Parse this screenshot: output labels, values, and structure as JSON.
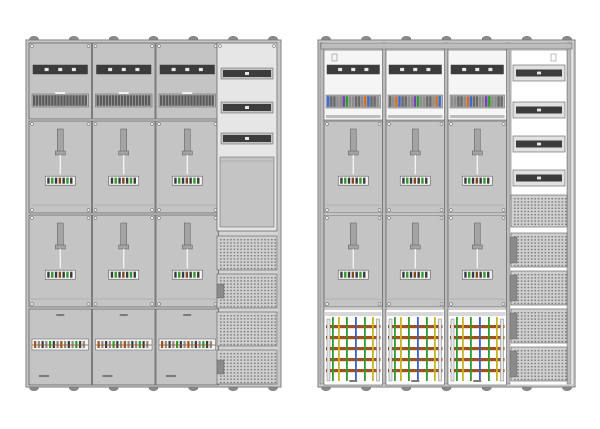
{
  "colors": {
    "background": "#ffffff",
    "frame": "#d4d4d4",
    "frame_stroke": "#7a7a7a",
    "panel": "#c4c4c4",
    "panel_light": "#e6e6e6",
    "panel_dark": "#9d9d9d",
    "rail": "#3c3c3c",
    "outline": "#5a5a5a",
    "busbar_brown": "#a0521d",
    "busbar_green": "#2f9a2f",
    "busbar_blue": "#3b5fc4",
    "busbar_yellow": "#c9b428",
    "busbar_white": "#f2f2f2",
    "terminal_blue": "#3b6bd0"
  },
  "diagrams": [
    {
      "name": "cabinet-closed-view",
      "icon": "meter-cabinet-front-icon",
      "meter_columns": 3,
      "meter_rows": 2,
      "side_column": "distribution-field",
      "state": "covered"
    },
    {
      "name": "cabinet-open-view",
      "icon": "meter-cabinet-interior-icon",
      "meter_columns": 3,
      "meter_rows": 2,
      "side_column": "distribution-field",
      "state": "open"
    }
  ],
  "legend": []
}
